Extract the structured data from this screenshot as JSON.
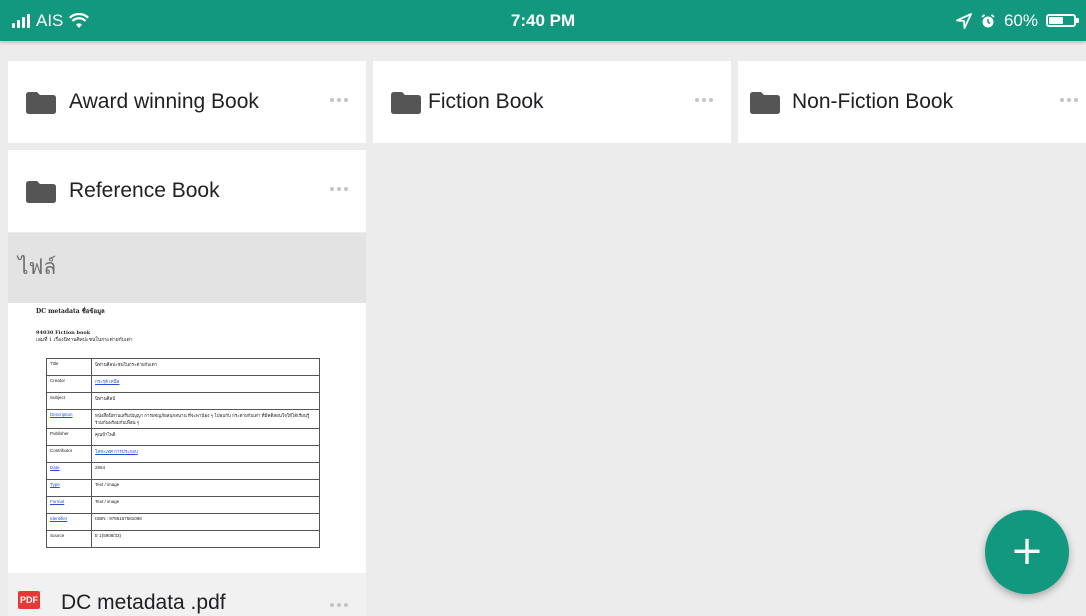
{
  "status_bar": {
    "carrier": "AIS",
    "time": "7:40 PM",
    "battery": "60%",
    "battery_level": 0.6,
    "icons": [
      "signal-icon",
      "wifi-icon",
      "location-arrow-icon",
      "alarm-icon",
      "battery-icon"
    ]
  },
  "folders": [
    {
      "label": "Award winning Book",
      "icon": "folder-icon"
    },
    {
      "label": "Fiction Book",
      "icon": "folder-icon"
    },
    {
      "label": "Non-Fiction Book",
      "icon": "folder-icon"
    },
    {
      "label": "Reference Book",
      "icon": "folder-icon"
    }
  ],
  "files_section": {
    "title": "ไฟล์"
  },
  "files": [
    {
      "name": "DC metadata .pdf",
      "type_badge": "PDF",
      "preview": {
        "title": "DC metadata ชื่อข้อมูล",
        "subtitle": "94030 Fiction book",
        "subtitle2": "เล่มที่ 1 เรื่องนิทานศิลปะชนในกระต่ายกับเต่า",
        "rows": [
          {
            "k": "Title",
            "v": "นิทานศิลปะชนในกระต่ายกับเต่า"
          },
          {
            "k": "Creator",
            "v": "กระรุต้ เหนือ"
          },
          {
            "k": "Subject",
            "v": "นิทานศิลป์"
          },
          {
            "k": "Description",
            "v": "หนังสือนิทานเสริมปัญญา การผจญภัยสนุกสนาน ที่จะพาน้อง ๆ ไปพบกับ กระต่ายกับเต่า ที่มีคติสอนใจให้ได้เรียนรู้ร่วมกันพร้อมกับเพื่อน ๆ"
          },
          {
            "k": "Publisher",
            "v": "คุณป้าไพลิ"
          },
          {
            "k": "Contributor",
            "v": "โลหะเทศ การประกอบ"
          },
          {
            "k": "Date",
            "v": "2554"
          },
          {
            "k": "Type",
            "v": "Text / image"
          },
          {
            "k": "Format",
            "v": "Text / image"
          },
          {
            "k": "Identifier",
            "v": "ISBN : 9786167581088"
          },
          {
            "k": "Source",
            "v": "E 1(5908/33)"
          }
        ]
      }
    }
  ],
  "fab": {
    "label": "+",
    "icon": "plus-icon"
  },
  "colors": {
    "accent": "#139880",
    "background": "#ececec",
    "card": "#ffffff",
    "pdf_red": "#e53935"
  }
}
